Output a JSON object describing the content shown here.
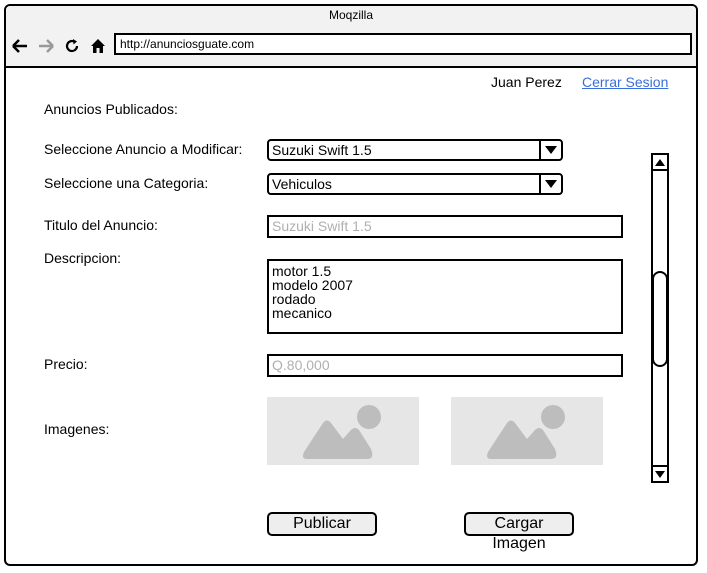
{
  "browser": {
    "title": "Moqzilla",
    "url": "http://anunciosguate.com",
    "icons": [
      "back-arrow-icon",
      "forward-arrow-icon",
      "reload-icon",
      "home-icon"
    ]
  },
  "header": {
    "user_name": "Juan Perez",
    "logout_label": "Cerrar Sesion"
  },
  "form": {
    "section_title": "Anuncios Publicados:",
    "select_ad_label": "Seleccione Anuncio a Modificar:",
    "select_ad_value": "Suzuki Swift 1.5",
    "category_label": "Seleccione una Categoria:",
    "category_value": "Vehiculos",
    "title_label": "Titulo del Anuncio:",
    "title_placeholder": "Suzuki Swift 1.5",
    "description_label": "Descripcion:",
    "description_lines": [
      "motor 1.5",
      "modelo 2007",
      "rodado",
      "mecanico"
    ],
    "price_label": "Precio:",
    "price_placeholder": "Q.80,000",
    "images_label": "Imagenes:",
    "publish_button": "Publicar",
    "upload_button": "Cargar Imagen"
  },
  "colors": {
    "link": "#3a6fd8",
    "placeholder": "#b0b0b0",
    "image_bg": "#e6e6e6",
    "image_icon": "#bdbdbd"
  }
}
